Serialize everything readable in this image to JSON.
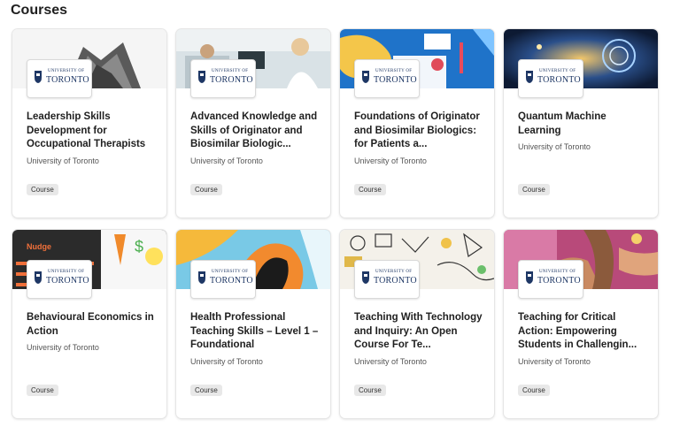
{
  "page": {
    "heading": "Courses"
  },
  "logo": {
    "small": "UNIVERSITY OF",
    "name": "TORONTO"
  },
  "courses": [
    {
      "title": "Leadership Skills Development for Occupational Therapists",
      "partner": "University of Toronto",
      "type": "Course",
      "banner": "abstract-gray"
    },
    {
      "title": "Advanced Knowledge and Skills of Originator and Biosimilar Biologic...",
      "partner": "University of Toronto",
      "type": "Course",
      "banner": "clinic-photo"
    },
    {
      "title": "Foundations of Originator and Biosimilar Biologics: for Patients a...",
      "partner": "University of Toronto",
      "type": "Course",
      "banner": "medical-illustration"
    },
    {
      "title": "Quantum Machine Learning",
      "partner": "University of Toronto",
      "type": "Course",
      "banner": "quantum-lights"
    },
    {
      "title": "Behavioural Economics in Action",
      "partner": "University of Toronto",
      "type": "Course",
      "banner": "nudge-graphic",
      "banner_text": "Nudge"
    },
    {
      "title": "Health Professional Teaching Skills – Level 1 – Foundational",
      "partner": "University of Toronto",
      "type": "Course",
      "banner": "colorful-swirls"
    },
    {
      "title": "Teaching With Technology and Inquiry: An Open Course For Te...",
      "partner": "University of Toronto",
      "type": "Course",
      "banner": "doodles"
    },
    {
      "title": "Teaching for Critical Action: Empowering Students in Challengin...",
      "partner": "University of Toronto",
      "type": "Course",
      "banner": "hands-photo"
    }
  ],
  "colors": {
    "uoft_blue": "#1e3765",
    "badge_bg": "#e8e8e8"
  }
}
